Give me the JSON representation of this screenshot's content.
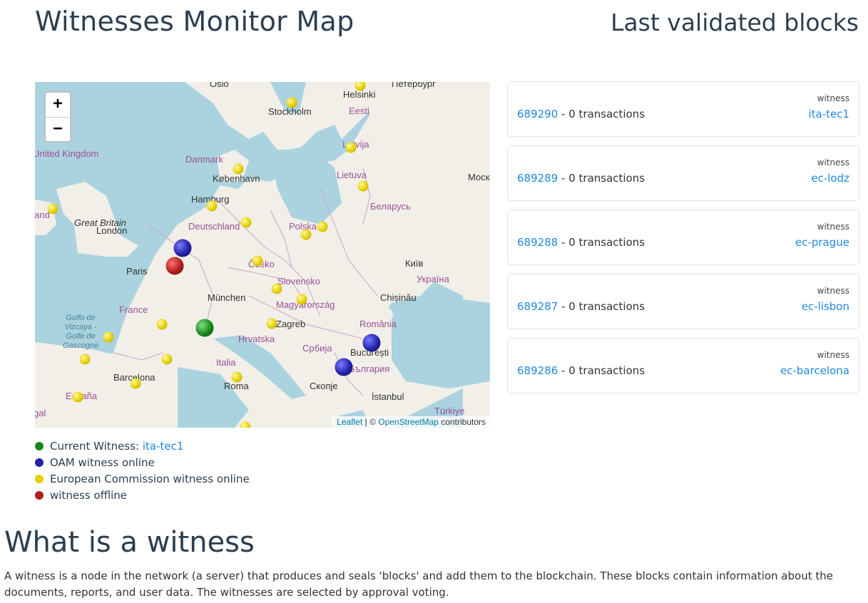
{
  "header": {
    "title": "Witnesses Monitor Map",
    "blocks_title": "Last validated blocks"
  },
  "map": {
    "zoom_in": "+",
    "zoom_out": "−",
    "labels": {
      "oslo": "Oslo",
      "peterburg": "Петербург",
      "helsinki": "Helsinki",
      "stockholm": "Stockholm",
      "eesti": "Eesti",
      "united_kingdom": "United Kingdom",
      "danmark": "Danmark",
      "kobenhavn": "København",
      "latvija": "Latvija",
      "lietuva": "Lietuva",
      "moskva": "Моск",
      "hamburg": "Hamburg",
      "ireland": "and",
      "great_britain": "Great Britain",
      "london": "London",
      "deutschland": "Deutschland",
      "polska": "Polska",
      "belarus": "Беларусь",
      "paris": "Paris",
      "cesko": "Česko",
      "kyiv": "Київ",
      "slovensko": "Slovensko",
      "ukraina": "Україна",
      "munchen": "München",
      "chisinau": "Chișinău",
      "france": "France",
      "magyarorszag": "Magyarország",
      "golfo": "Golfo de Vizcaya - Golfe de Gascogne",
      "zagreb": "Zagreb",
      "romania": "România",
      "hrvatska": "Hrvatska",
      "srbija": "Србија",
      "bucuresti": "București",
      "italia": "Italia",
      "bulgaria": "България",
      "barcelona": "Barcelona",
      "roma": "Roma",
      "skopje": "Скопје",
      "espana": "España",
      "istanbul": "İstanbul",
      "portugal": "gal",
      "turkiye": "Türkiye"
    },
    "attribution": {
      "leaflet": "Leaflet",
      "separator": " | © ",
      "osm": "OpenStreetMap",
      "suffix": " contributors"
    }
  },
  "legend": {
    "current_label": "Current Witness: ",
    "current_witness": "ita-tec1",
    "oam": "OAM witness online",
    "ec": "European Commission witness online",
    "offline": "witness offline",
    "colors": {
      "green": "#16881a",
      "blue": "#2222aa",
      "yellow": "#e6cf00",
      "red": "#b21d1d"
    }
  },
  "blocks": [
    {
      "number": "689290",
      "tx": " - 0 transactions",
      "witness_label": "witness",
      "witness": "ita-tec1"
    },
    {
      "number": "689289",
      "tx": " - 0 transactions",
      "witness_label": "witness",
      "witness": "ec-lodz"
    },
    {
      "number": "689288",
      "tx": " - 0 transactions",
      "witness_label": "witness",
      "witness": "ec-prague"
    },
    {
      "number": "689287",
      "tx": " - 0 transactions",
      "witness_label": "witness",
      "witness": "ec-lisbon"
    },
    {
      "number": "689286",
      "tx": " - 0 transactions",
      "witness_label": "witness",
      "witness": "ec-barcelona"
    }
  ],
  "about": {
    "title": "What is a witness",
    "text": "A witness is a node in the network (a server) that produces and seals 'blocks' and add them to the blockchain. These blocks contain information about the documents, reports, and user data. The witnesses are selected by approval voting."
  }
}
